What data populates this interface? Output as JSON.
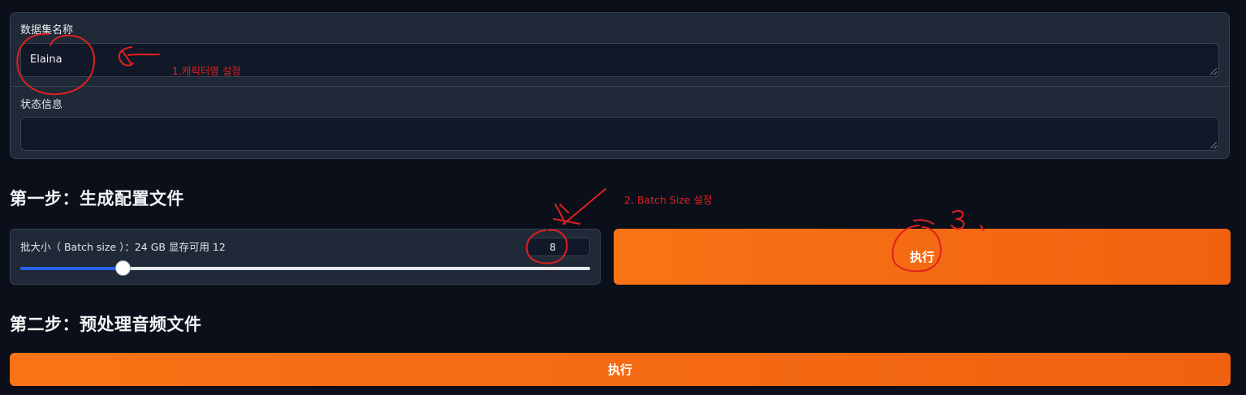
{
  "dataset": {
    "name_label": "数据集名称",
    "name_value": "Elaina",
    "status_label": "状态信息",
    "status_value": ""
  },
  "step1": {
    "title": "第一步：生成配置文件",
    "batch_label": "批大小（ Batch size ）：24 GB 显存可用 12",
    "batch_value": "8",
    "batch_min": 1,
    "batch_max": 40,
    "run_label": "执行"
  },
  "step2": {
    "title": "第二步：预处理音频文件",
    "run_label": "执行"
  },
  "annotations": {
    "note1": "1.캐릭터명 설정",
    "note2": "2. Batch Size 설정",
    "note3": "3 ,"
  },
  "colors": {
    "accent_orange": "#f97316",
    "slider_blue": "#2563eb",
    "annotation_red": "#e02020"
  }
}
